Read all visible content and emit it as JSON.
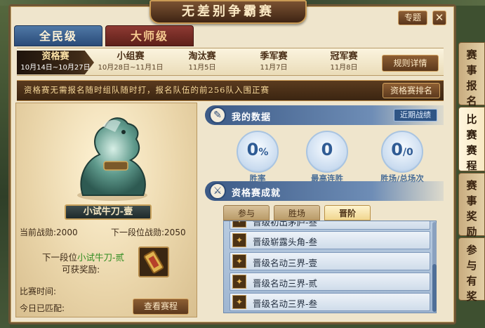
{
  "window": {
    "title": "无差别争霸赛",
    "topic_label": "专题",
    "close_label": "✕"
  },
  "tiers": [
    {
      "label": "全民级",
      "active": true
    },
    {
      "label": "大师级",
      "active": false
    }
  ],
  "stages": [
    {
      "name": "资格赛",
      "date": "10月14日~10月27日",
      "active": true
    },
    {
      "name": "小组赛",
      "date": "10月28日~11月1日",
      "active": false
    },
    {
      "name": "淘汰赛",
      "date": "11月5日",
      "active": false
    },
    {
      "name": "季军赛",
      "date": "11月7日",
      "active": false
    },
    {
      "name": "冠军赛",
      "date": "11月8日",
      "active": false
    }
  ],
  "rules_button": "规则详情",
  "notice": "资格赛无需报名随时组队随时打，报名队伍的前256队入围正赛",
  "ranking_button": "资格赛排名",
  "rank": {
    "name": "小试牛刀-壹",
    "current_power_label": "当前战勋:",
    "current_power": "2000",
    "next_power_label": "下一段位战勋:",
    "next_power": "2050",
    "next_tier_prefix": "下一段位",
    "next_tier_name": "小试牛刀-贰",
    "reward_label": "可获奖励:",
    "match_time_label": "比赛时间:",
    "matched_today_label": "今日已匹配:",
    "view_schedule_button": "查看赛程"
  },
  "my_data": {
    "title": "我的数据",
    "recent_button": "近期战绩",
    "stats": [
      {
        "value": "0",
        "unit": "%",
        "label": "胜率"
      },
      {
        "value": "0",
        "unit": "",
        "label": "最高连胜"
      },
      {
        "value": "0",
        "unit": "/0",
        "label": "胜场/总场次"
      }
    ]
  },
  "achievements": {
    "title": "资格赛成就",
    "tabs": [
      {
        "label": "参与",
        "active": false
      },
      {
        "label": "胜场",
        "active": false
      },
      {
        "label": "晋阶",
        "active": true
      }
    ],
    "items": [
      {
        "name": "晋级初出茅庐-叁"
      },
      {
        "name": "晋级崭露头角-叁"
      },
      {
        "name": "晋级名动三界-壹"
      },
      {
        "name": "晋级名动三界-贰"
      },
      {
        "name": "晋级名动三界-叁"
      }
    ]
  },
  "side_tabs": [
    {
      "label": "赛事报名",
      "active": false
    },
    {
      "label": "比赛赛程",
      "active": true
    },
    {
      "label": "赛事奖励",
      "active": false
    },
    {
      "label": "参与有奖",
      "active": false
    }
  ],
  "colors": {
    "accent_gold": "#c99b55",
    "panel_blue": "#3c5a86",
    "highlight_green": "#2e8b1f"
  }
}
